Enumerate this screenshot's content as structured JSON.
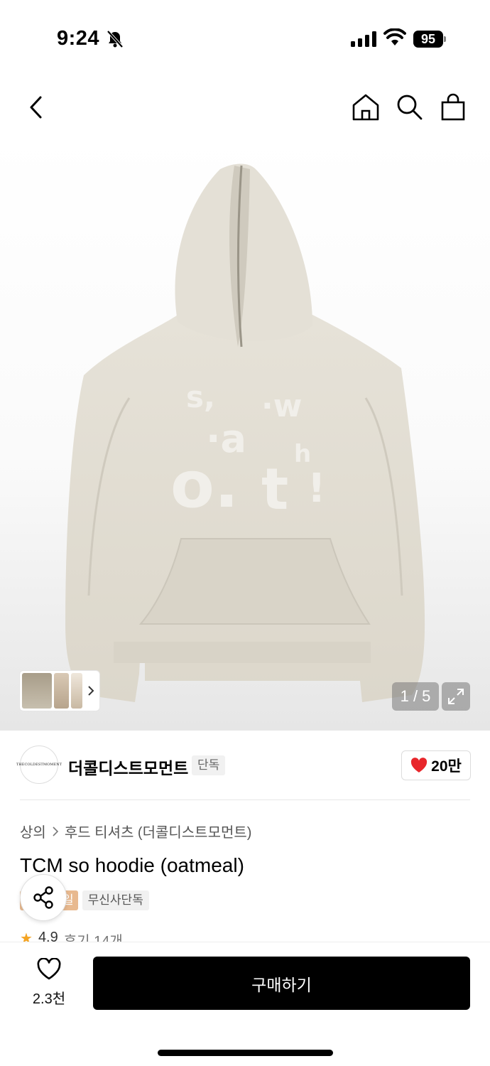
{
  "status_bar": {
    "time": "9:24",
    "battery": "95"
  },
  "nav": {
    "icons": [
      "back-icon",
      "home-icon",
      "search-icon",
      "bag-icon"
    ]
  },
  "gallery": {
    "counter": "1 / 5"
  },
  "brand": {
    "name": "더콜디스트모먼트",
    "tag": "단독",
    "likes": "20만",
    "logo_text": "THECOLDESTMOMENT"
  },
  "breadcrumb": {
    "category": "상의",
    "subcategory": "후드 티셔츠 (더콜디스트모먼트)"
  },
  "product": {
    "title": "TCM so hoodie (oatmeal)",
    "badge_sale": "일",
    "badge_exclusive": "무신사단독",
    "rating": "4.9",
    "reviews": "후기 14개"
  },
  "bottom": {
    "wish_count": "2.3천",
    "buy_label": "구매하기"
  },
  "colors": {
    "like_heart": "#e8262b",
    "sale_badge": "#e8b98f",
    "star": "#f4a423",
    "buy_button": "#000000"
  }
}
